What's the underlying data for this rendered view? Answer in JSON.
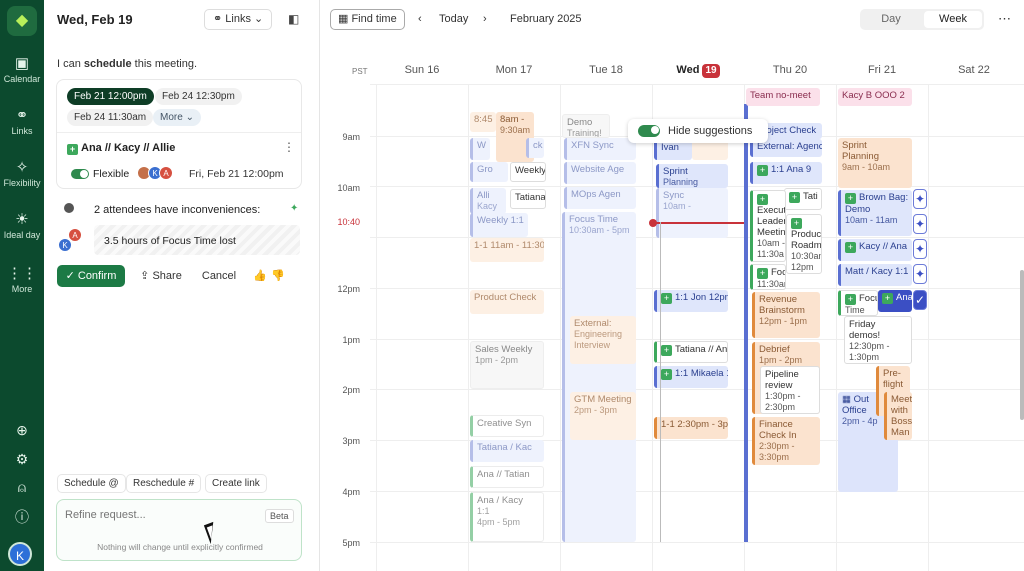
{
  "rail": {
    "items": [
      {
        "label": "Calendar",
        "icon": "calendar-plus-icon"
      },
      {
        "label": "Links",
        "icon": "link-icon"
      },
      {
        "label": "Flexibility",
        "icon": "sparkle-icon"
      },
      {
        "label": "Ideal day",
        "icon": "sun-icon"
      },
      {
        "label": "More",
        "icon": "grid-icon"
      }
    ],
    "avatar": "K"
  },
  "panel": {
    "date": "Wed, Feb 19",
    "links_label": "Links",
    "intro_prefix": "I can",
    "intro_bold": "schedule",
    "intro_suffix": "this meeting.",
    "slots": [
      "Feb 21 12:00pm",
      "Feb 24 12:30pm",
      "Feb 24 11:30am"
    ],
    "more_label": "More",
    "meeting_title": "Ana // Kacy // Allie",
    "flexible_label": "Flexible",
    "meeting_time": "Fri, Feb 21 12:00pm",
    "inconvenience_text": "2 attendees have inconveniences:",
    "focus_lost": "3.5 hours of Focus Time lost",
    "confirm_label": "Confirm",
    "share_label": "Share",
    "cancel_label": "Cancel",
    "quick_actions": [
      "Schedule @",
      "Reschedule #",
      "Create link"
    ],
    "refine_placeholder": "Refine request...",
    "beta_label": "Beta",
    "refine_note": "Nothing will change until explicitly confirmed"
  },
  "calendar": {
    "find_time": "Find time",
    "today": "Today",
    "month": "February 2025",
    "view_day": "Day",
    "view_week": "Week",
    "tz": "PST",
    "days": [
      {
        "label": "Sun 16"
      },
      {
        "label": "Mon 17"
      },
      {
        "label": "Tue 18"
      },
      {
        "label": "Wed",
        "badge": "19"
      },
      {
        "label": "Thu 20"
      },
      {
        "label": "Fri 21"
      },
      {
        "label": "Sat 22"
      }
    ],
    "hours": [
      "9am",
      "10am",
      "12pm",
      "1pm",
      "2pm",
      "3pm",
      "4pm",
      "5pm"
    ],
    "now_label": "10:40",
    "hide_suggestions": "Hide suggestions",
    "events": {
      "mon": [
        {
          "t": "8:45",
          "s": ""
        },
        {
          "t": "8am -",
          "s": "9:30am"
        },
        {
          "t": "W",
          "s": ""
        },
        {
          "t": "ck",
          "s": ""
        },
        {
          "t": "Gro",
          "s": ""
        },
        {
          "t": "Weekly",
          "s": ""
        },
        {
          "t": "Alli",
          "s": "Kacy"
        },
        {
          "t": "Weekly 1:1",
          "s": ""
        },
        {
          "t": "Tatiana",
          "s": ""
        },
        {
          "t": "1-1 11am - 11:30",
          "s": ""
        },
        {
          "t": "Product Check",
          "s": ""
        },
        {
          "t": "Sales Weekly",
          "s": "1pm - 2pm"
        },
        {
          "t": "Creative Syn",
          "s": ""
        },
        {
          "t": "Tatiana / Kac",
          "s": ""
        },
        {
          "t": "Ana // Tatian",
          "s": ""
        },
        {
          "t": "Ana / Kacy",
          "s": "1:1"
        },
        {
          "t": "4pm - 5pm",
          "s": ""
        }
      ],
      "tue": [
        {
          "t": "Demo",
          "s": "Training!"
        },
        {
          "t": "XFN Sync",
          "s": ""
        },
        {
          "t": "Website Age",
          "s": ""
        },
        {
          "t": "MOps Agen",
          "s": ""
        },
        {
          "t": "Focus Time",
          "s": "10:30am - 5pm"
        },
        {
          "t": "External:",
          "s": "Engineering"
        },
        {
          "t": "Interview",
          "s": "12:30pm -"
        },
        {
          "t": "GTM Meeting",
          "s": "2pm - 3pm"
        }
      ],
      "wed": [
        {
          "t": "Ivan",
          "s": ""
        },
        {
          "t": "Sprint",
          "s": "Planning"
        },
        {
          "t": "Sync",
          "s": "10am -"
        },
        {
          "t": "1:1 Jon",
          "s": "12pm"
        },
        {
          "t": "Tatiana // An",
          "s": ""
        },
        {
          "t": "1:1 Mikaela",
          "s": "1"
        },
        {
          "t": "1-1 2:30pm - 3p",
          "s": ""
        }
      ],
      "thu": [
        {
          "t": "Team no-meet",
          "s": ""
        },
        {
          "t": "Project Check",
          "s": ""
        },
        {
          "t": "External: Agenc",
          "s": ""
        },
        {
          "t": "1:1 Ana 9",
          "s": ""
        },
        {
          "t": "Tati",
          "s": ""
        },
        {
          "t": "Execut",
          "s": "Leader"
        },
        {
          "t": "Meetin",
          "s": "10am -"
        },
        {
          "t": "11:30a",
          "s": ""
        },
        {
          "t": "Produc",
          "s": "Roadm"
        },
        {
          "t": "10:30am",
          "s": "12pm"
        },
        {
          "t": "Focu",
          "s": "11:30am -"
        },
        {
          "t": "Revenue",
          "s": "Brainstorm"
        },
        {
          "t": "12pm - 1pm",
          "s": ""
        },
        {
          "t": "Debrief",
          "s": "1pm - 2pm"
        },
        {
          "t": "Pipeline",
          "s": "review"
        },
        {
          "t": "1:30pm -",
          "s": "2:30pm"
        },
        {
          "t": "Finance",
          "s": "Check In"
        },
        {
          "t": "2:30pm -",
          "s": "3:30pm"
        }
      ],
      "fri": [
        {
          "t": "Kacy B OOO 2",
          "s": ""
        },
        {
          "t": "Sprint",
          "s": "Planning"
        },
        {
          "t": "9am - 10am",
          "s": ""
        },
        {
          "t": "Brown Bag:",
          "s": "Demo"
        },
        {
          "t": "10am - 11am",
          "s": ""
        },
        {
          "t": "Kacy // Ana",
          "s": ""
        },
        {
          "t": "Matt / Kacy 1:1",
          "s": ""
        },
        {
          "t": "Focu",
          "s": "Time"
        },
        {
          "t": "Ana",
          "s": ""
        },
        {
          "t": "Friday",
          "s": "demos!"
        },
        {
          "t": "12:30pm -",
          "s": "1:30pm"
        },
        {
          "t": "Pre-",
          "s": "flight"
        },
        {
          "t": "Out",
          "s": "Office"
        },
        {
          "t": "2pm - 4p",
          "s": ""
        },
        {
          "t": "Meet",
          "s": "with"
        },
        {
          "t": "Boss",
          "s": "Man"
        }
      ]
    }
  }
}
